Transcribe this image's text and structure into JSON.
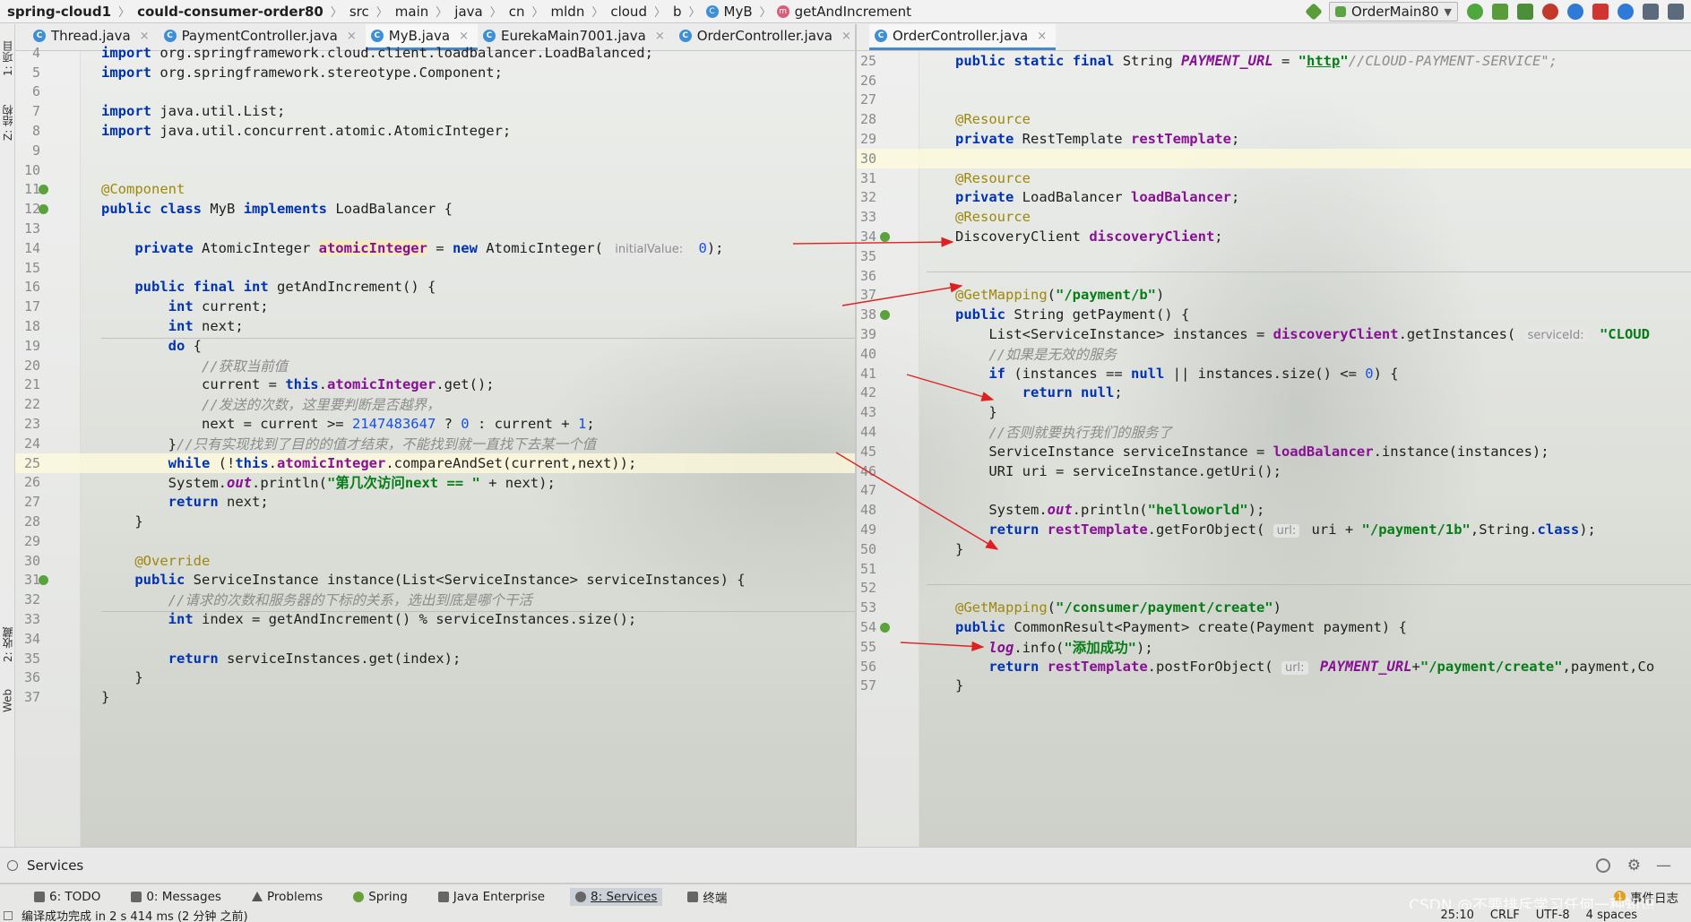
{
  "breadcrumb": [
    "spring-cloud1",
    "could-consumer-order80",
    "src",
    "main",
    "java",
    "cn",
    "mldn",
    "cloud",
    "b",
    "MyB",
    "getAndIncrement"
  ],
  "run_config": "OrderMain80",
  "left_tabs": [
    {
      "label": "Thread.java"
    },
    {
      "label": "PaymentController.java"
    },
    {
      "label": "MyB.java"
    },
    {
      "label": "EurekaMain7001.java"
    },
    {
      "label": "OrderController.java"
    }
  ],
  "right_tabs": [
    {
      "label": "OrderController.java"
    }
  ],
  "side_tabs": {
    "project": "1: 项目",
    "structure": "Z: 结构",
    "favorites": "2: 收藏",
    "web": "Web"
  },
  "left_lines": [
    {
      "n": "4",
      "code": "import org.springframework.cloud.client.loadbalancer.LoadBalanced;"
    },
    {
      "n": "5",
      "code": "import org.springframework.stereotype.Component;"
    },
    {
      "n": "6",
      "code": ""
    },
    {
      "n": "7",
      "code": "import java.util.List;"
    },
    {
      "n": "8",
      "code": "import java.util.concurrent.atomic.AtomicInteger;"
    },
    {
      "n": "9",
      "code": ""
    },
    {
      "n": "10",
      "code": ""
    },
    {
      "n": "11",
      "code": "@Component"
    },
    {
      "n": "12",
      "code": "public class MyB implements LoadBalancer {"
    },
    {
      "n": "13",
      "code": ""
    },
    {
      "n": "14",
      "code": "    private AtomicInteger atomicInteger = new AtomicInteger( initialValue: 0);"
    },
    {
      "n": "15",
      "code": ""
    },
    {
      "n": "16",
      "code": "    public final int getAndIncrement() {"
    },
    {
      "n": "17",
      "code": "        int current;"
    },
    {
      "n": "18",
      "code": "        int next;"
    },
    {
      "n": "19",
      "code": "        do {"
    },
    {
      "n": "20",
      "code": "            //获取当前值"
    },
    {
      "n": "21",
      "code": "            current = this.atomicInteger.get();"
    },
    {
      "n": "22",
      "code": "            //发送的次数，这里要判断是否越界，"
    },
    {
      "n": "23",
      "code": "            next = current >= 2147483647 ? 0 : current + 1;"
    },
    {
      "n": "24",
      "code": "        }//只有实现找到了目的的值才结束，不能找到就一直找下去某一个值"
    },
    {
      "n": "25",
      "code": "        while (!this.atomicInteger.compareAndSet(current,next));"
    },
    {
      "n": "26",
      "code": "        System.out.println(\"第几次访问next == \" + next);"
    },
    {
      "n": "27",
      "code": "        return next;"
    },
    {
      "n": "28",
      "code": "    }"
    },
    {
      "n": "29",
      "code": ""
    },
    {
      "n": "30",
      "code": "    @Override"
    },
    {
      "n": "31",
      "code": "    public ServiceInstance instance(List<ServiceInstance> serviceInstances) {"
    },
    {
      "n": "32",
      "code": "        //请求的次数和服务器的下标的关系，选出到底是哪个干活"
    },
    {
      "n": "33",
      "code": "        int index = getAndIncrement() % serviceInstances.size();"
    },
    {
      "n": "34",
      "code": ""
    },
    {
      "n": "35",
      "code": "        return serviceInstances.get(index);"
    },
    {
      "n": "36",
      "code": "    }"
    },
    {
      "n": "37",
      "code": "}"
    }
  ],
  "right_lines": [
    {
      "n": "25",
      "code": "public static final String PAYMENT_URL = \"http://CLOUD-PAYMENT-SERVICE\";"
    },
    {
      "n": "26",
      "code": ""
    },
    {
      "n": "27",
      "code": ""
    },
    {
      "n": "28",
      "code": "@Resource"
    },
    {
      "n": "29",
      "code": "private RestTemplate restTemplate;"
    },
    {
      "n": "30",
      "code": ""
    },
    {
      "n": "31",
      "code": "@Resource"
    },
    {
      "n": "32",
      "code": "private LoadBalancer loadBalancer;"
    },
    {
      "n": "33",
      "code": "@Resource"
    },
    {
      "n": "34",
      "code": "DiscoveryClient discoveryClient;"
    },
    {
      "n": "35",
      "code": ""
    },
    {
      "n": "36",
      "code": ""
    },
    {
      "n": "37",
      "code": "@GetMapping(\"/payment/b\")"
    },
    {
      "n": "38",
      "code": "public String getPayment() {"
    },
    {
      "n": "39",
      "code": "    List<ServiceInstance> instances = discoveryClient.getInstances( serviceId: \"CLOUD"
    },
    {
      "n": "40",
      "code": "    //如果是无效的服务"
    },
    {
      "n": "41",
      "code": "    if (instances == null || instances.size() <= 0) {"
    },
    {
      "n": "42",
      "code": "        return null;"
    },
    {
      "n": "43",
      "code": "    }"
    },
    {
      "n": "44",
      "code": "    //否则就要执行我们的服务了"
    },
    {
      "n": "45",
      "code": "    ServiceInstance serviceInstance = loadBalancer.instance(instances);"
    },
    {
      "n": "46",
      "code": "    URI uri = serviceInstance.getUri();"
    },
    {
      "n": "47",
      "code": ""
    },
    {
      "n": "48",
      "code": "    System.out.println(\"helloworld\");"
    },
    {
      "n": "49",
      "code": "    return restTemplate.getForObject( url: uri + \"/payment/1b\",String.class);"
    },
    {
      "n": "50",
      "code": "}"
    },
    {
      "n": "51",
      "code": ""
    },
    {
      "n": "52",
      "code": ""
    },
    {
      "n": "53",
      "code": "@GetMapping(\"/consumer/payment/create\")"
    },
    {
      "n": "54",
      "code": "public CommonResult<Payment> create(Payment payment) {"
    },
    {
      "n": "55",
      "code": "    log.info(\"添加成功\");"
    },
    {
      "n": "56",
      "code": "    return restTemplate.postForObject( url: PAYMENT_URL+\"/payment/create\",payment,Co"
    },
    {
      "n": "57",
      "code": "}"
    }
  ],
  "services_label": "Services",
  "tool_windows": [
    {
      "label": "6: TODO"
    },
    {
      "label": "0: Messages"
    },
    {
      "label": "Problems"
    },
    {
      "label": "Spring"
    },
    {
      "label": "Java Enterprise"
    },
    {
      "label": "8: Services"
    },
    {
      "label": "终端"
    }
  ],
  "event_log": "事件日志",
  "event_count": "1",
  "status_message": "编译成功完成 in 2 s 414 ms (2 分钟 之前)",
  "status_right": {
    "position": "25:10",
    "line_sep": "CRLF",
    "encoding": "UTF-8",
    "indent": "4 spaces"
  },
  "watermark": "CSDN @不要排斥学习任何一种知识",
  "colors": {
    "keyword": "#0033b3",
    "annotation": "#9e880d",
    "comment": "#8c8c8c",
    "string": "#067d17",
    "field": "#871094",
    "number": "#1750eb",
    "arrow": "#e02020",
    "active_tab": "#4a88c7"
  }
}
